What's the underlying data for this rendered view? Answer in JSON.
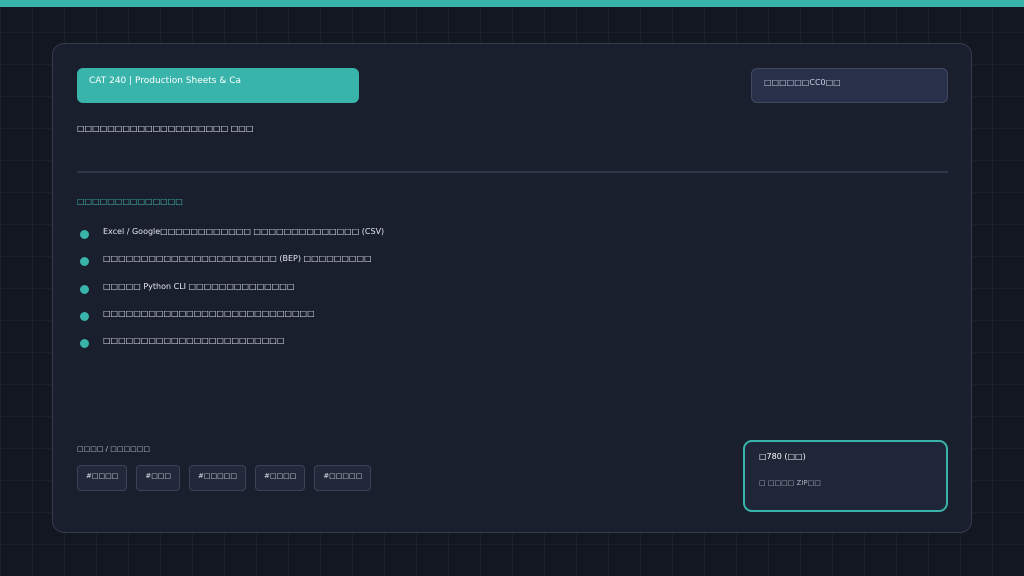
{
  "header": {
    "title": "CAT 240 | Production Sheets & Ca",
    "license": "□□□□□□CC0□□"
  },
  "subtitle": "□□□□□□□□□□□□□□□□□□□□ □□□",
  "features": {
    "heading": "□□□□□□□□□□□□□□",
    "items": [
      "Excel / Google□□□□□□□□□□□□ □□□□□□□□□□□□□□ (CSV)",
      "□□□□□□□□□□□□□□□□□□□□□□□ (BEP) □□□□□□□□□",
      "□□□□□ Python CLI □□□□□□□□□□□□□□",
      "□□□□□□□□□□□□□□□□□□□□□□□□□□□□",
      "□□□□□□□□□□□□□□□□□□□□□□□□"
    ]
  },
  "tags": {
    "label": "□□□□ / □□□□□□",
    "items": [
      "#□□□□",
      "#□□□",
      "#□□□□□",
      "#□□□□",
      "#□□□□□"
    ]
  },
  "purchase": {
    "price": "□780 (□□)",
    "note": "□ □□□□ ZIP□□"
  },
  "colors": {
    "accent": "#38b4ab",
    "background": "#131722",
    "card": "#1a1f2d"
  }
}
